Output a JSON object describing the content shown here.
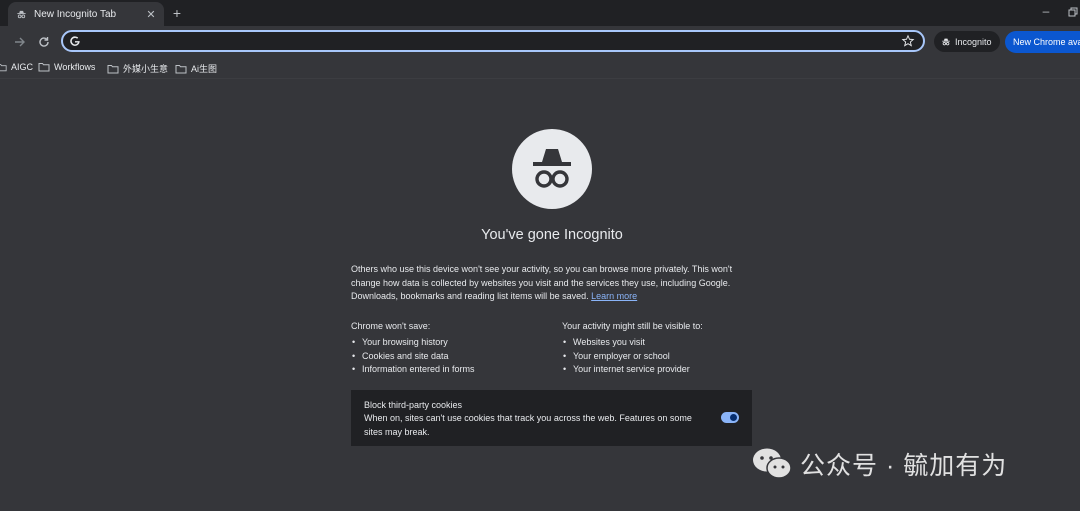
{
  "tab": {
    "title": "New Incognito Tab",
    "close_glyph": "✕",
    "icon": "incognito-icon"
  },
  "new_tab_glyph": "+",
  "window": {
    "minimize_glyph": "–"
  },
  "toolbar": {
    "omnibox_value": "",
    "incognito_label": "Incognito",
    "new_chrome_label": "New Chrome available"
  },
  "bookmarks": [
    {
      "label": "AIGC",
      "icon": "folder-icon"
    },
    {
      "label": "Workflows",
      "icon": "folder-icon"
    },
    {
      "label": "外媒小生意",
      "icon": "folder-icon"
    },
    {
      "label": "Ai生图",
      "icon": "folder-icon"
    }
  ],
  "page": {
    "title": "You've gone Incognito",
    "intro_text": "Others who use this device won't see your activity, so you can browse more privately. This won't change how data is collected by websites you visit and the services they use, including Google. Downloads, bookmarks and reading list items will be saved.",
    "learn_more": "Learn more",
    "wont_save": {
      "title": "Chrome won't save:",
      "items": [
        "Your browsing history",
        "Cookies and site data",
        "Information entered in forms"
      ]
    },
    "might_be_visible": {
      "title": "Your activity might still be visible to:",
      "items": [
        "Websites you visit",
        "Your employer or school",
        "Your internet service provider"
      ]
    },
    "cookies": {
      "title": "Block third-party cookies",
      "description": "When on, sites can't use cookies that track you across the web. Features on some sites may break.",
      "enabled": true
    }
  },
  "watermark": "公众号 · 毓加有为",
  "colors": {
    "accent": "#a8c7fa",
    "link": "#8ab4f8",
    "button_blue": "#0b57d0",
    "background": "#35363a"
  }
}
